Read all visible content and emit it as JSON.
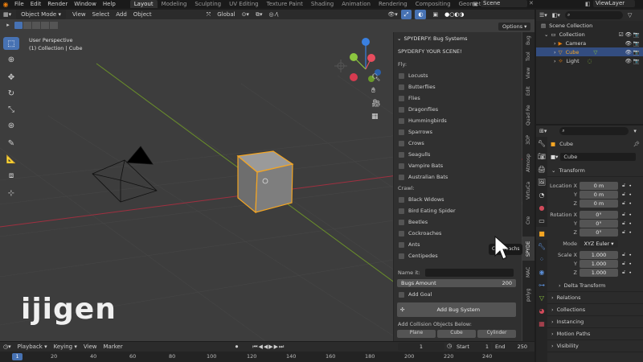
{
  "topbar": {
    "menus": [
      "File",
      "Edit",
      "Render",
      "Window",
      "Help"
    ],
    "workspaces": [
      "Layout",
      "Modeling",
      "Sculpting",
      "UV Editing",
      "Texture Paint",
      "Shading",
      "Animation",
      "Rendering",
      "Compositing",
      "Geometry Nodes"
    ],
    "active_workspace": "Layout",
    "scene": "Scene",
    "view_layer": "ViewLayer"
  },
  "viewport_header": {
    "mode": "Object Mode",
    "menus": [
      "View",
      "Select",
      "Add",
      "Object"
    ],
    "transform_orientation": "Global",
    "options": "Options"
  },
  "viewport": {
    "perspective": "User Perspective",
    "collection_info": "(1) Collection | Cube",
    "watermark": "ijigen",
    "tooltip_fragment": "Cockroachs"
  },
  "npanel": {
    "title": "SPYDERFY: Bug Systems",
    "subtitle": "SPYDERFY YOUR SCENE!",
    "fly_label": "Fly:",
    "fly_items": [
      "Locusts",
      "Butterflies",
      "Flies",
      "Dragonflies",
      "Hummingbirds",
      "Sparrows",
      "Crows",
      "Seagulls",
      "Vampire Bats",
      "Australian Bats"
    ],
    "crawl_label": "Crawl:",
    "crawl_items": [
      "Black Widows",
      "Bird Eating Spider",
      "Beetles",
      "Cockroaches",
      "Ants",
      "Centipedes"
    ],
    "name_label": "Name it:",
    "bugs_amount_label": "Bugs Amount",
    "bugs_amount_value": "200",
    "add_goal": "Add Goal",
    "add_bug_system": "Add Bug System",
    "collision_label": "Add Collision Objects Below:",
    "collision_buttons": [
      "Plane",
      "Cube",
      "Cylinder"
    ]
  },
  "vtabs": [
    "Bug",
    "Tool",
    "View",
    "Edit",
    "Quad Re",
    "3DP",
    "Atmosp",
    "VirtuCa",
    "Cre",
    "SPYDE",
    "MAC",
    "polyg"
  ],
  "outliner": {
    "rows": [
      {
        "label": "Scene Collection"
      },
      {
        "label": "Collection"
      },
      {
        "label": "Camera"
      },
      {
        "label": "Cube"
      },
      {
        "label": "Light"
      }
    ]
  },
  "properties": {
    "object_name": "Cube",
    "data_name": "Cube",
    "transform_label": "Transform",
    "location_label": "Location X",
    "rotation_label": "Rotation X",
    "scale_label": "Scale X",
    "y_label": "Y",
    "z_label": "Z",
    "mode_label": "Mode",
    "location": [
      "0 m",
      "0 m",
      "0 m"
    ],
    "rotation": [
      "0°",
      "0°",
      "0°"
    ],
    "scale": [
      "1.000",
      "1.000",
      "1.000"
    ],
    "rotation_mode": "XYZ Euler",
    "sections": [
      "Delta Transform",
      "Relations",
      "Collections",
      "Instancing",
      "Motion Paths",
      "Visibility"
    ]
  },
  "timeline": {
    "menus": [
      "Playback",
      "Keying",
      "View",
      "Marker"
    ],
    "current_frame": "1",
    "start_label": "Start",
    "start": "1",
    "end_label": "End",
    "end": "250",
    "ruler": [
      "20",
      "40",
      "60",
      "80",
      "100",
      "120",
      "140",
      "160",
      "180",
      "200",
      "220",
      "240"
    ],
    "ruler_current": "1"
  },
  "colors": {
    "accent": "#4772b3",
    "selection_orange": "#f5a623",
    "axis_x": "#e84d5e",
    "axis_y": "#8cc63f",
    "axis_z": "#3a80e0"
  }
}
